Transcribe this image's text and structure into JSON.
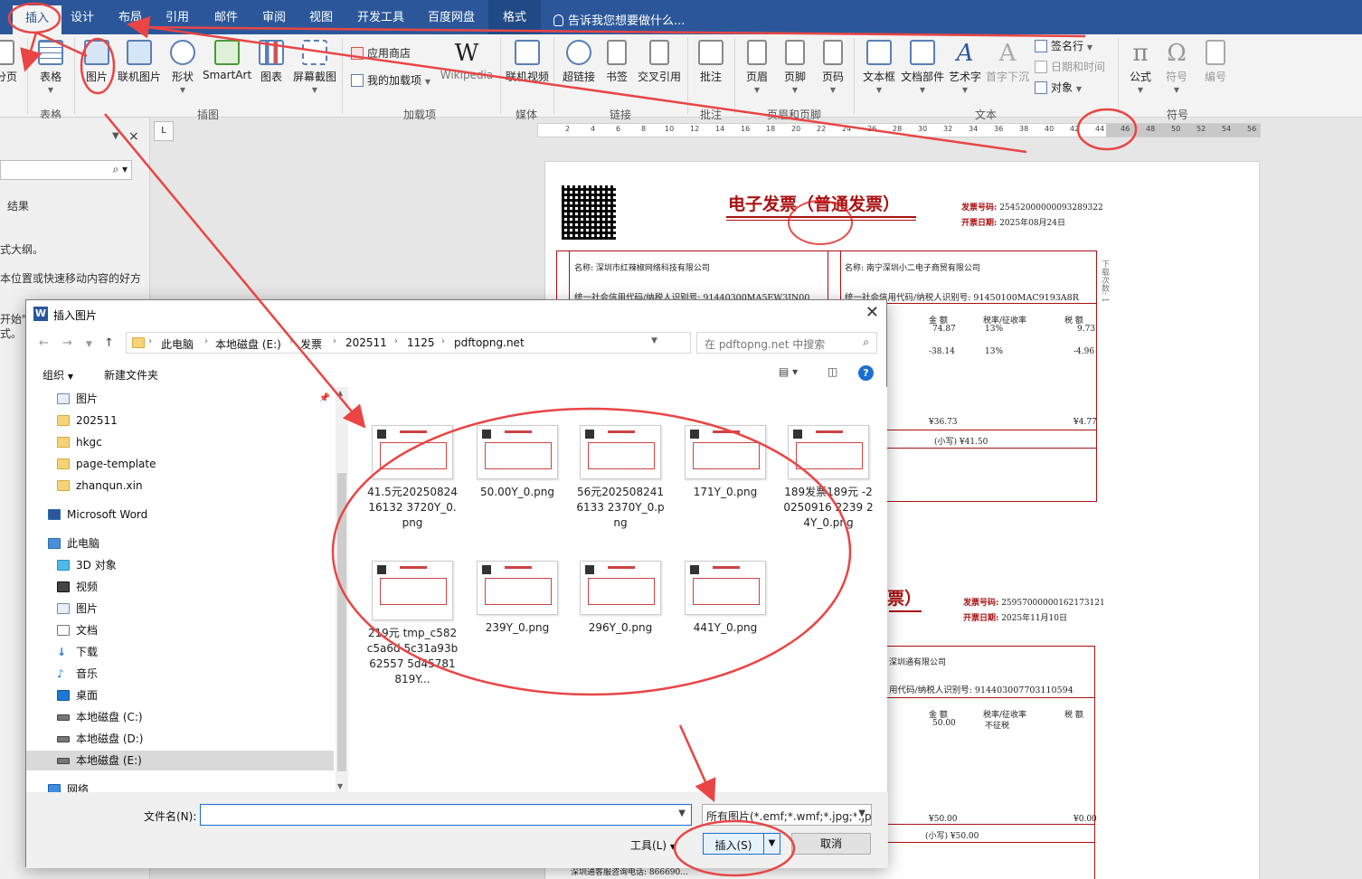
{
  "ribbon": {
    "tabs": [
      "插入",
      "设计",
      "布局",
      "引用",
      "邮件",
      "审阅",
      "视图",
      "开发工具",
      "百度网盘",
      "格式"
    ],
    "tell_me": "告诉我您想要做什么...",
    "groups": {
      "table": "表格",
      "illustrations": "插图",
      "addins": "加载项",
      "media": "媒体",
      "links": "链接",
      "comments": "批注",
      "header_footer": "页眉和页脚",
      "text": "文本",
      "symbols": "符号"
    },
    "buttons": {
      "page_break": "分页",
      "table": "表格",
      "picture": "图片",
      "online_picture": "联机图片",
      "shapes": "形状",
      "smartart": "SmartArt",
      "chart": "图表",
      "screenshot": "屏幕截图",
      "store": "应用商店",
      "my_addins": "我的加载项",
      "wikipedia": "Wikipedia",
      "online_video": "联机视频",
      "hyperlink": "超链接",
      "bookmark": "书签",
      "cross_ref": "交叉引用",
      "comment": "批注",
      "header": "页眉",
      "footer": "页脚",
      "page_number": "页码",
      "textbox": "文本框",
      "quick_parts": "文档部件",
      "wordart": "艺术字",
      "dropcap": "首字下沉",
      "signature": "签名行",
      "datetime": "日期和时间",
      "object": "对象",
      "equation": "公式",
      "symbol": "符号",
      "number": "编号"
    }
  },
  "ruler": {
    "ticks": [
      "2",
      "4",
      "6",
      "8",
      "10",
      "12",
      "14",
      "16",
      "18",
      "20",
      "22",
      "24",
      "26",
      "28",
      "30",
      "32",
      "34",
      "36",
      "38",
      "40",
      "42",
      "44",
      "46",
      "48",
      "50",
      "52",
      "54",
      "56"
    ],
    "corner": "L"
  },
  "navpane": {
    "results": "结果",
    "line1": "式大纲。",
    "line2": "本位置或快速移动内容的好方",
    "line3": "开始\"",
    "line4": "式。"
  },
  "document": {
    "invoice1": {
      "title": "电子发票（普通发票）",
      "invoice_no_label": "发票号码:",
      "invoice_no": "25452000000093289322",
      "date_label": "开票日期:",
      "date": "2025年08月24日",
      "buyer_name": "名称: 深圳市红辣椒网络科技有限公司",
      "buyer_id": "统一社会信用代码/纳税人识别号: 91440300MA5EW3JN00",
      "seller_name": "名称: 南宁深圳小二电子商贸有限公司",
      "seller_id": "统一社会信用代码/纳税人识别号: 91450100MAC9193A8R",
      "amount_header": "金 额",
      "rate_header": "税率/征收率",
      "tax_header": "税 额",
      "row1_amount": "74.87",
      "row1_rate": "13%",
      "row1_tax": "9.73",
      "row2_amount": "-38.14",
      "row2_rate": "13%",
      "row2_tax": "-4.96",
      "total_amount": "¥36.73",
      "total_tax": "¥4.77",
      "grand_total": "(小写) ¥41.50",
      "side_note": "下载次数: 1"
    },
    "invoice2": {
      "title_tail": "票）",
      "invoice_no_label": "发票号码:",
      "invoice_no": "25957000000162173121",
      "date_label": "开票日期:",
      "date": "2025年11月10日",
      "seller_name": "深圳通有限公司",
      "seller_id": "用代码/纳税人识别号: 914403007703110594",
      "amount_header": "金 额",
      "rate_header": "税率/征收率",
      "tax_header": "税 额",
      "row1_amount": "50.00",
      "row1_rate": "不征税",
      "total_amount": "¥50.00",
      "total_tax": "¥0.00",
      "grand_total": "(小写) ¥50.00",
      "footer": "深圳通客服咨询电话: 866690..."
    }
  },
  "dialog": {
    "title": "插入图片",
    "breadcrumb": [
      "此电脑",
      "本地磁盘 (E:)",
      "发票",
      "202511",
      "1125",
      "pdftopng.net"
    ],
    "search_placeholder": "在 pdftopng.net 中搜索",
    "organize": "组织",
    "new_folder": "新建文件夹",
    "tree": [
      {
        "label": "图片",
        "icon": "pictures-folder-icon"
      },
      {
        "label": "202511",
        "icon": "folder-icon"
      },
      {
        "label": "hkgc",
        "icon": "folder-icon"
      },
      {
        "label": "page-template",
        "icon": "folder-icon"
      },
      {
        "label": "zhanqun.xin",
        "icon": "folder-icon"
      },
      {
        "label": "Microsoft Word",
        "icon": "word-icon"
      },
      {
        "label": "此电脑",
        "icon": "this-pc-icon"
      },
      {
        "label": "3D 对象",
        "icon": "3d-objects-icon"
      },
      {
        "label": "视频",
        "icon": "videos-icon"
      },
      {
        "label": "图片",
        "icon": "pictures-icon"
      },
      {
        "label": "文档",
        "icon": "documents-icon"
      },
      {
        "label": "下载",
        "icon": "downloads-icon"
      },
      {
        "label": "音乐",
        "icon": "music-icon"
      },
      {
        "label": "桌面",
        "icon": "desktop-icon"
      },
      {
        "label": "本地磁盘 (C:)",
        "icon": "drive-icon"
      },
      {
        "label": "本地磁盘 (D:)",
        "icon": "drive-icon"
      },
      {
        "label": "本地磁盘 (E:)",
        "icon": "drive-icon"
      },
      {
        "label": "网络",
        "icon": "network-icon"
      }
    ],
    "files": [
      "41.5元2025082416132 3720Y_0.png",
      "50.00Y_0.png",
      "56元2025082416133 2370Y_0.png",
      "171Y_0.png",
      "189发票189元 -20250916 2239 24Y_0.png",
      "219元 tmp_c582c5a6d 5c31a93b62557 5d45781819Y...",
      "239Y_0.png",
      "296Y_0.png",
      "441Y_0.png"
    ],
    "filename_label": "文件名(N):",
    "filename_value": "",
    "filter": "所有图片(*.emf;*.wmf;*.jpg;*.jpeg",
    "tools": "工具(L)",
    "insert": "插入(S)",
    "cancel": "取消"
  }
}
